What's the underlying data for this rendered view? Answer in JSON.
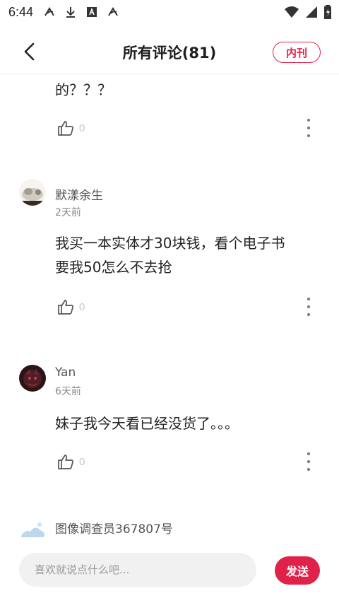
{
  "status_bar": {
    "time": "6:44"
  },
  "header": {
    "title": "所有评论(81)",
    "badge": "内刊"
  },
  "top_comment": {
    "text": "的？？？",
    "likes": "0"
  },
  "comments": [
    {
      "username": "默漾余生",
      "date": "2天前",
      "lines": [
        "我买一本实体才30块钱，看个电子书",
        "要我50怎么不去抢"
      ],
      "likes": "0"
    },
    {
      "username": "Yan",
      "date": "6天前",
      "lines": [
        "妹子我今天看已经没货了。。。"
      ],
      "likes": "0"
    },
    {
      "username": "图像调查员367807号"
    }
  ],
  "input_bar": {
    "placeholder": "喜欢就说点什么吧...",
    "send_label": "发送"
  },
  "colors": {
    "accent": "#e0224a"
  }
}
